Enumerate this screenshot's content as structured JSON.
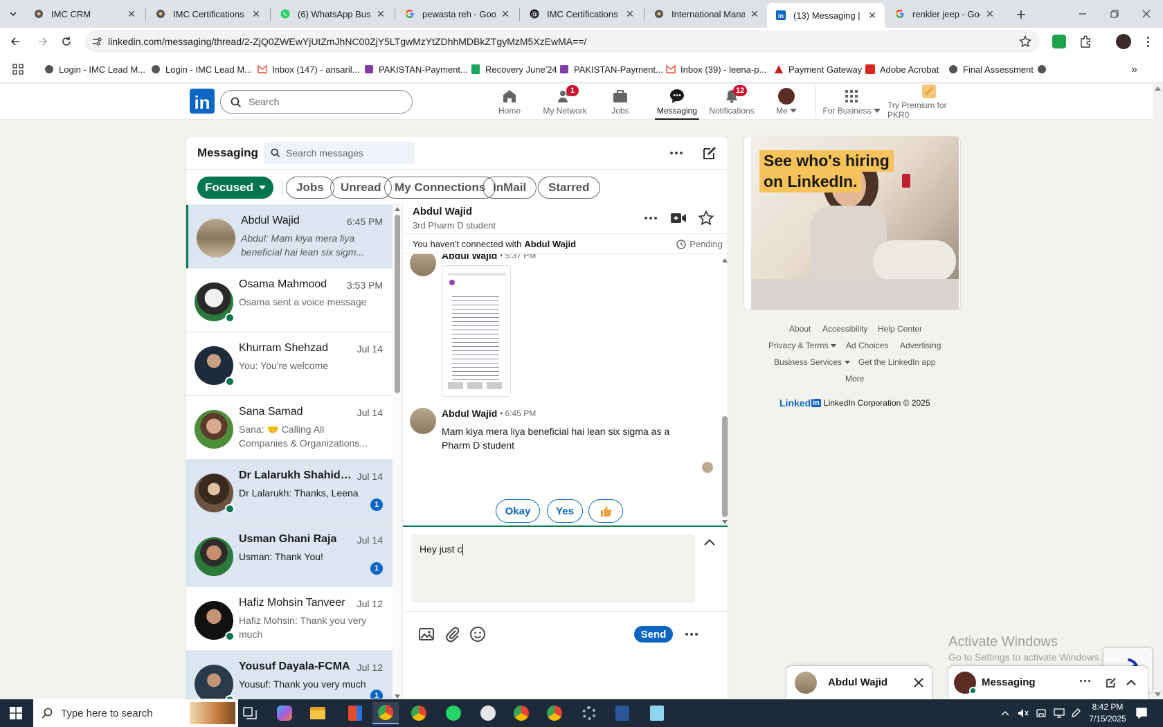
{
  "browser": {
    "tabs": [
      {
        "title": "IMC CRM",
        "icon": "imc-icon"
      },
      {
        "title": "IMC Certifications -",
        "icon": "imc-icon"
      },
      {
        "title": "(6) WhatsApp Busin",
        "icon": "whatsapp-icon"
      },
      {
        "title": "pewasta reh - Goog",
        "icon": "google-icon"
      },
      {
        "title": "IMC Certifications In",
        "icon": "threads-icon"
      },
      {
        "title": "International Manag",
        "icon": "imc-icon"
      },
      {
        "title": "(13) Messaging | Lin",
        "icon": "linkedin-icon"
      },
      {
        "title": "renkler jeep - Goog",
        "icon": "google-icon"
      }
    ],
    "url": "linkedin.com/messaging/thread/2-ZjQ0ZWEwYjUtZmJhNC00ZjY5LTgwMzYtZDhhMDBkZTgyMzM5XzEwMA==/",
    "bookmarks": [
      "Login - IMC Lead M...",
      "Login - IMC Lead M...",
      "Inbox (147) - ansaril...",
      "PAKISTAN-Payment...",
      "Recovery June'24",
      "PAKISTAN-Payment...",
      "Inbox (39) - leena-p...",
      "Payment Gateway",
      "Adobe Acrobat",
      "Final Assessment"
    ]
  },
  "linkedin": {
    "search_placeholder": "Search",
    "nav": {
      "home": "Home",
      "network": "My Network",
      "network_badge": "1",
      "jobs": "Jobs",
      "messaging": "Messaging",
      "notifications": "Notifications",
      "notifications_badge": "12",
      "me": "Me",
      "business": "For Business",
      "premium": "Try Premium for PKR0"
    },
    "messaging": {
      "title": "Messaging",
      "search_placeholder": "Search messages",
      "filters": [
        "Focused",
        "Jobs",
        "Unread",
        "My Connections",
        "InMail",
        "Starred"
      ],
      "conversations": [
        {
          "name": "Abdul Wajid",
          "time": "6:45 PM",
          "preview": "Abdul: Mam kiya mera liya beneficial hai lean six sigm..."
        },
        {
          "name": "Osama Mahmood",
          "time": "3:53 PM",
          "preview": "Osama sent a voice message"
        },
        {
          "name": "Khurram Shehzad",
          "time": "Jul 14",
          "preview": "You: You're welcome"
        },
        {
          "name": "Sana Samad",
          "time": "Jul 14",
          "preview": "Sana: 🤝 Calling All Companies & Organizations..."
        },
        {
          "name": "Dr Lalarukh Shahid T...",
          "time": "Jul 14",
          "preview": "Dr Lalarukh: Thanks, Leena",
          "unread": "1"
        },
        {
          "name": "Usman Ghani Raja",
          "time": "Jul 14",
          "preview": "Usman: Thank You!",
          "unread": "1"
        },
        {
          "name": "Hafiz Mohsin Tanveer",
          "time": "Jul 12",
          "preview": "Hafiz Mohsin: Thank you very much"
        },
        {
          "name": "Yousuf Dayala-FCMA",
          "time": "Jul 12",
          "preview": "Yousuf: Thank you very much",
          "unread": "1"
        }
      ],
      "thread": {
        "name": "Abdul Wajid",
        "headline": "3rd Pharm D student",
        "connect_notice_prefix": "You haven't connected with",
        "connect_notice_name": "Abdul Wajid",
        "pending": "Pending",
        "msg1_sender": "Abdul Wajid",
        "msg1_time": "• 5:37 PM",
        "msg2_sender": "Abdul Wajid",
        "msg2_time": "• 6:45 PM",
        "msg2_text": "Mam kiya mera liya beneficial hai lean six sigma as a Pharm D student",
        "quick_replies": [
          "Okay",
          "Yes"
        ],
        "draft": "Hey just c",
        "send": "Send"
      }
    },
    "ad": {
      "headline_1": "See who's hiring",
      "headline_2": "on LinkedIn."
    },
    "footer": {
      "about": "About",
      "accessibility": "Accessibility",
      "help": "Help Center",
      "privacy": "Privacy & Terms",
      "adchoices": "Ad Choices",
      "advertising": "Advertising",
      "business": "Business Services",
      "app": "Get the LinkedIn app",
      "more": "More",
      "brand": "Linked",
      "copyright": "LinkedIn Corporation © 2025"
    },
    "popups": {
      "chat_name": "Abdul Wajid",
      "messaging": "Messaging"
    }
  },
  "windows": {
    "activate_title": "Activate Windows",
    "activate_sub": "Go to Settings to activate Windows.",
    "search_placeholder": "Type here to search",
    "time": "8:42 PM",
    "date": "7/15/2025"
  },
  "colors": {
    "linkedin_blue": "#0a66c2",
    "focused_green": "#01754f",
    "badge_red": "#cb112d",
    "unread_bg": "#dce6f1"
  }
}
